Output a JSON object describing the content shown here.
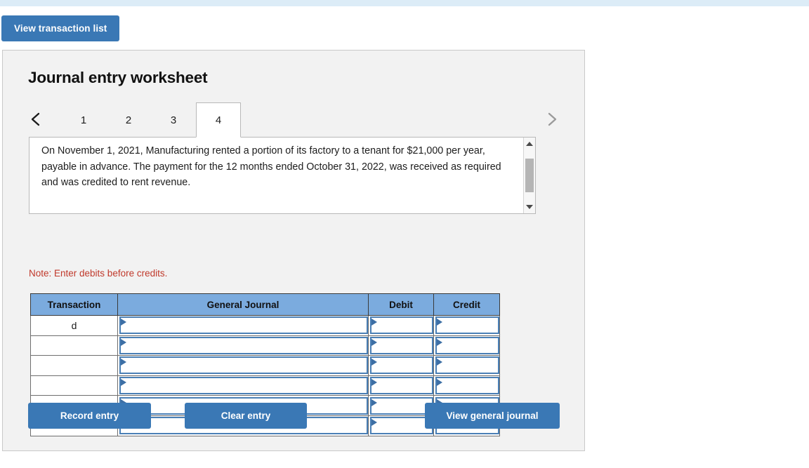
{
  "theme": {
    "accent_blue": "#3a78b5",
    "table_header_blue": "#7babde",
    "field_border_blue": "#4a7fb5",
    "panel_bg": "#f2f2f2",
    "top_strip": "#dcecf7",
    "note_red": "#c0392b"
  },
  "toolbar": {
    "view_transaction_list_label": "View transaction list"
  },
  "panel": {
    "title": "Journal entry worksheet"
  },
  "tabs": {
    "prev_icon": "chevron-left-icon",
    "next_icon": "chevron-right-icon",
    "items": [
      {
        "label": "1",
        "active": false
      },
      {
        "label": "2",
        "active": false
      },
      {
        "label": "3",
        "active": false
      },
      {
        "label": "4",
        "active": true
      }
    ],
    "active_index": 3
  },
  "scenario": {
    "text": "On November 1, 2021, Manufacturing rented a portion of its factory to a tenant for $21,000 per year, payable in advance. The payment for the 12 months ended October 31, 2022, was received as required and was credited to rent revenue.",
    "scrollbar": {
      "up_icon": "scroll-up-arrow-icon",
      "down_icon": "scroll-down-arrow-icon"
    }
  },
  "note": {
    "text": "Note: Enter debits before credits."
  },
  "journal_table": {
    "columns": [
      "Transaction",
      "General Journal",
      "Debit",
      "Credit"
    ],
    "rows": [
      {
        "transaction": "d",
        "general_journal": "",
        "debit": "",
        "credit": ""
      },
      {
        "transaction": "",
        "general_journal": "",
        "debit": "",
        "credit": ""
      },
      {
        "transaction": "",
        "general_journal": "",
        "debit": "",
        "credit": ""
      },
      {
        "transaction": "",
        "general_journal": "",
        "debit": "",
        "credit": ""
      },
      {
        "transaction": "",
        "general_journal": "",
        "debit": "",
        "credit": ""
      },
      {
        "transaction": "",
        "general_journal": "",
        "debit": "",
        "credit": ""
      }
    ]
  },
  "actions": {
    "record_entry_label": "Record entry",
    "clear_entry_label": "Clear entry",
    "view_general_journal_label": "View general journal"
  }
}
